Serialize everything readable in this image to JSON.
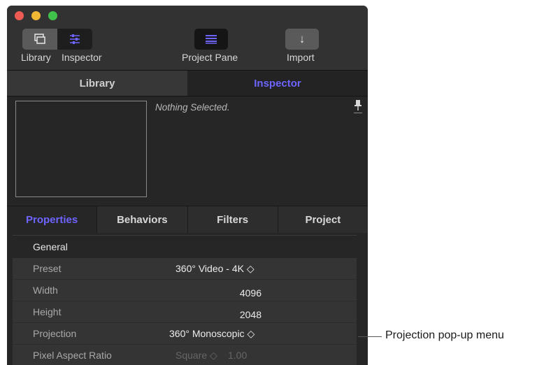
{
  "toolbar": {
    "library_label": "Library",
    "inspector_label": "Inspector",
    "project_pane_label": "Project Pane",
    "import_label": "Import",
    "import_glyph": "↓"
  },
  "tabs": {
    "library": "Library",
    "inspector": "Inspector"
  },
  "preview": {
    "status_text": "Nothing Selected."
  },
  "inspector_tabs": [
    "Properties",
    "Behaviors",
    "Filters",
    "Project"
  ],
  "active_inspector_tab": "Properties",
  "properties": {
    "group": "General",
    "preset": {
      "label": "Preset",
      "value": "360° Video - 4K ◇"
    },
    "width": {
      "label": "Width",
      "value": "4096"
    },
    "height": {
      "label": "Height",
      "value": "2048"
    },
    "projection": {
      "label": "Projection",
      "value": "360° Monoscopic ◇"
    },
    "pixel_aspect_ratio": {
      "label": "Pixel Aspect Ratio",
      "value": "Square ◇",
      "number": "1.00"
    }
  },
  "callout": {
    "text": "Projection pop-up menu"
  },
  "colors": {
    "accent": "#6e64ff",
    "window_bg": "#2a2a2a",
    "row_bg": "#343434"
  }
}
